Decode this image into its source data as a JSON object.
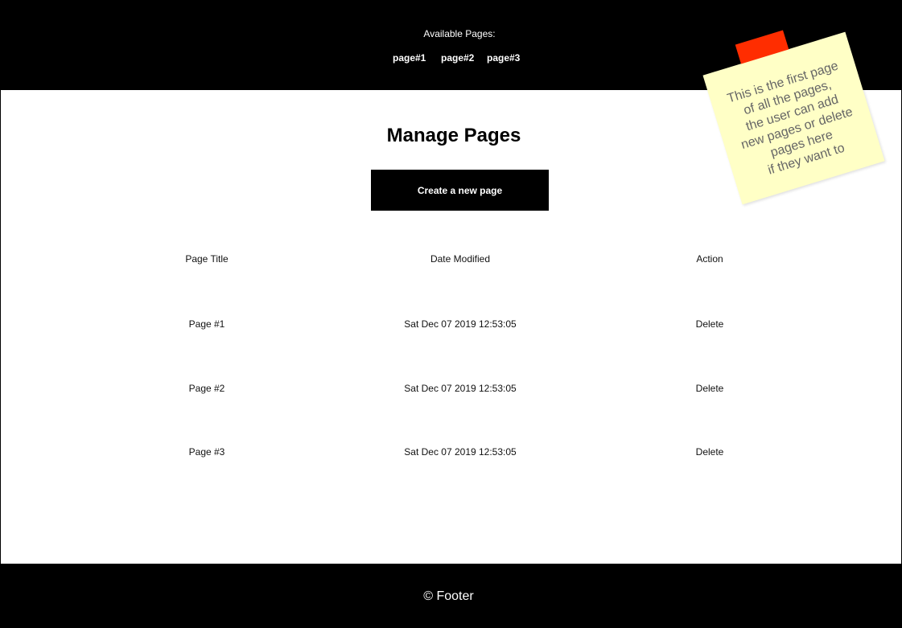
{
  "header": {
    "label": "Available Pages:",
    "nav": [
      {
        "label": "page#1"
      },
      {
        "label": "page#2"
      },
      {
        "label": "page#3"
      }
    ]
  },
  "main": {
    "title": "Manage Pages",
    "create_button_label": "Create a new page",
    "table": {
      "columns": [
        "Page Title",
        "Date Modified",
        "Action"
      ],
      "rows": [
        {
          "title": "Page #1",
          "modified": "Sat Dec 07 2019 12:53:05",
          "action": "Delete"
        },
        {
          "title": "Page #2",
          "modified": "Sat Dec 07 2019 12:53:05",
          "action": "Delete"
        },
        {
          "title": "Page #3",
          "modified": "Sat Dec 07 2019 12:53:05",
          "action": "Delete"
        }
      ]
    }
  },
  "sticky_note": {
    "text": "This is the first page\nof all the pages,\nthe user can add\nnew pages or delete\npages here\nif they want to"
  },
  "footer": {
    "text": "© Footer"
  },
  "colors": {
    "header_bg": "#000000",
    "sticky_bg": "#ffffc6",
    "sticky_tape": "#ff2d00"
  }
}
